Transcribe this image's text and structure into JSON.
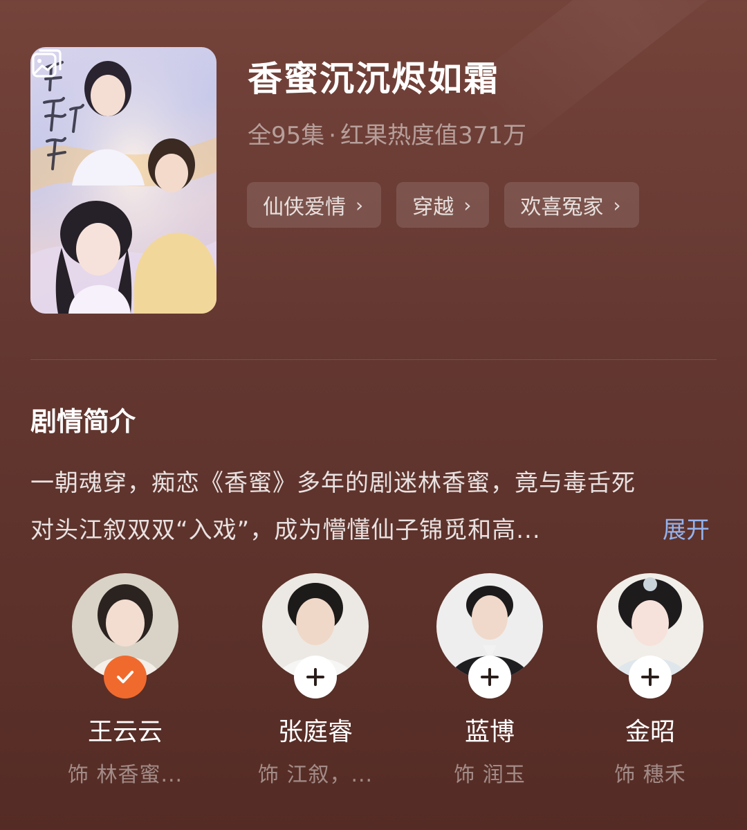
{
  "show": {
    "title": "香蜜沉沉烬如霜",
    "episodes": "全95集",
    "heat": "红果热度值371万",
    "tags": [
      {
        "label": "仙侠爱情"
      },
      {
        "label": "穿越"
      },
      {
        "label": "欢喜冤家"
      }
    ]
  },
  "synopsis": {
    "title": "剧情简介",
    "line1": "一朝魂穿，痴恋《香蜜》多年的剧迷林香蜜，竟与毒舌死",
    "line2": "对头江叙双双“入戏”，成为懵懂仙子锦觅和高...",
    "expand_label": "展开"
  },
  "cast": [
    {
      "name": "王云云",
      "role": "饰 林香蜜...",
      "followed": true
    },
    {
      "name": "张庭睿",
      "role": "饰 江叙，...",
      "followed": false
    },
    {
      "name": "蓝博",
      "role": "饰 润玉",
      "followed": false
    },
    {
      "name": "金昭",
      "role": "饰 穗禾",
      "followed": false
    }
  ],
  "icons": {
    "gallery": "gallery-icon",
    "chevron": "chevron-right-icon",
    "follow": "plus-icon",
    "followed": "checkmark-icon"
  },
  "colors": {
    "background": "#643831",
    "link": "#94b3ee",
    "followed_badge": "#f06a2e"
  }
}
